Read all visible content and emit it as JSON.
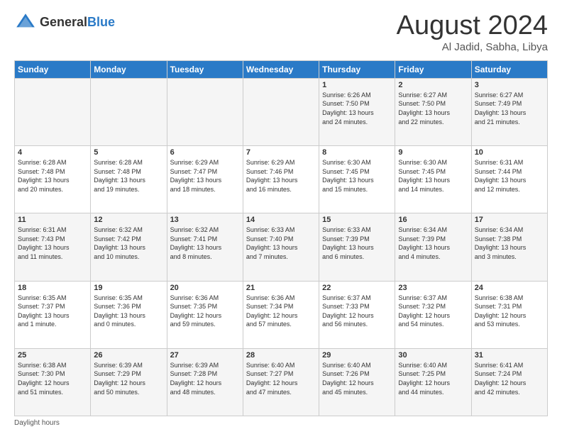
{
  "logo": {
    "line1": "General",
    "line2": "Blue"
  },
  "title": "August 2024",
  "subtitle": "Al Jadid, Sabha, Libya",
  "days_of_week": [
    "Sunday",
    "Monday",
    "Tuesday",
    "Wednesday",
    "Thursday",
    "Friday",
    "Saturday"
  ],
  "weeks": [
    [
      {
        "day": "",
        "info": ""
      },
      {
        "day": "",
        "info": ""
      },
      {
        "day": "",
        "info": ""
      },
      {
        "day": "",
        "info": ""
      },
      {
        "day": "1",
        "info": "Sunrise: 6:26 AM\nSunset: 7:50 PM\nDaylight: 13 hours\nand 24 minutes."
      },
      {
        "day": "2",
        "info": "Sunrise: 6:27 AM\nSunset: 7:50 PM\nDaylight: 13 hours\nand 22 minutes."
      },
      {
        "day": "3",
        "info": "Sunrise: 6:27 AM\nSunset: 7:49 PM\nDaylight: 13 hours\nand 21 minutes."
      }
    ],
    [
      {
        "day": "4",
        "info": "Sunrise: 6:28 AM\nSunset: 7:48 PM\nDaylight: 13 hours\nand 20 minutes."
      },
      {
        "day": "5",
        "info": "Sunrise: 6:28 AM\nSunset: 7:48 PM\nDaylight: 13 hours\nand 19 minutes."
      },
      {
        "day": "6",
        "info": "Sunrise: 6:29 AM\nSunset: 7:47 PM\nDaylight: 13 hours\nand 18 minutes."
      },
      {
        "day": "7",
        "info": "Sunrise: 6:29 AM\nSunset: 7:46 PM\nDaylight: 13 hours\nand 16 minutes."
      },
      {
        "day": "8",
        "info": "Sunrise: 6:30 AM\nSunset: 7:45 PM\nDaylight: 13 hours\nand 15 minutes."
      },
      {
        "day": "9",
        "info": "Sunrise: 6:30 AM\nSunset: 7:45 PM\nDaylight: 13 hours\nand 14 minutes."
      },
      {
        "day": "10",
        "info": "Sunrise: 6:31 AM\nSunset: 7:44 PM\nDaylight: 13 hours\nand 12 minutes."
      }
    ],
    [
      {
        "day": "11",
        "info": "Sunrise: 6:31 AM\nSunset: 7:43 PM\nDaylight: 13 hours\nand 11 minutes."
      },
      {
        "day": "12",
        "info": "Sunrise: 6:32 AM\nSunset: 7:42 PM\nDaylight: 13 hours\nand 10 minutes."
      },
      {
        "day": "13",
        "info": "Sunrise: 6:32 AM\nSunset: 7:41 PM\nDaylight: 13 hours\nand 8 minutes."
      },
      {
        "day": "14",
        "info": "Sunrise: 6:33 AM\nSunset: 7:40 PM\nDaylight: 13 hours\nand 7 minutes."
      },
      {
        "day": "15",
        "info": "Sunrise: 6:33 AM\nSunset: 7:39 PM\nDaylight: 13 hours\nand 6 minutes."
      },
      {
        "day": "16",
        "info": "Sunrise: 6:34 AM\nSunset: 7:39 PM\nDaylight: 13 hours\nand 4 minutes."
      },
      {
        "day": "17",
        "info": "Sunrise: 6:34 AM\nSunset: 7:38 PM\nDaylight: 13 hours\nand 3 minutes."
      }
    ],
    [
      {
        "day": "18",
        "info": "Sunrise: 6:35 AM\nSunset: 7:37 PM\nDaylight: 13 hours\nand 1 minute."
      },
      {
        "day": "19",
        "info": "Sunrise: 6:35 AM\nSunset: 7:36 PM\nDaylight: 13 hours\nand 0 minutes."
      },
      {
        "day": "20",
        "info": "Sunrise: 6:36 AM\nSunset: 7:35 PM\nDaylight: 12 hours\nand 59 minutes."
      },
      {
        "day": "21",
        "info": "Sunrise: 6:36 AM\nSunset: 7:34 PM\nDaylight: 12 hours\nand 57 minutes."
      },
      {
        "day": "22",
        "info": "Sunrise: 6:37 AM\nSunset: 7:33 PM\nDaylight: 12 hours\nand 56 minutes."
      },
      {
        "day": "23",
        "info": "Sunrise: 6:37 AM\nSunset: 7:32 PM\nDaylight: 12 hours\nand 54 minutes."
      },
      {
        "day": "24",
        "info": "Sunrise: 6:38 AM\nSunset: 7:31 PM\nDaylight: 12 hours\nand 53 minutes."
      }
    ],
    [
      {
        "day": "25",
        "info": "Sunrise: 6:38 AM\nSunset: 7:30 PM\nDaylight: 12 hours\nand 51 minutes."
      },
      {
        "day": "26",
        "info": "Sunrise: 6:39 AM\nSunset: 7:29 PM\nDaylight: 12 hours\nand 50 minutes."
      },
      {
        "day": "27",
        "info": "Sunrise: 6:39 AM\nSunset: 7:28 PM\nDaylight: 12 hours\nand 48 minutes."
      },
      {
        "day": "28",
        "info": "Sunrise: 6:40 AM\nSunset: 7:27 PM\nDaylight: 12 hours\nand 47 minutes."
      },
      {
        "day": "29",
        "info": "Sunrise: 6:40 AM\nSunset: 7:26 PM\nDaylight: 12 hours\nand 45 minutes."
      },
      {
        "day": "30",
        "info": "Sunrise: 6:40 AM\nSunset: 7:25 PM\nDaylight: 12 hours\nand 44 minutes."
      },
      {
        "day": "31",
        "info": "Sunrise: 6:41 AM\nSunset: 7:24 PM\nDaylight: 12 hours\nand 42 minutes."
      }
    ]
  ],
  "footer": "Daylight hours"
}
